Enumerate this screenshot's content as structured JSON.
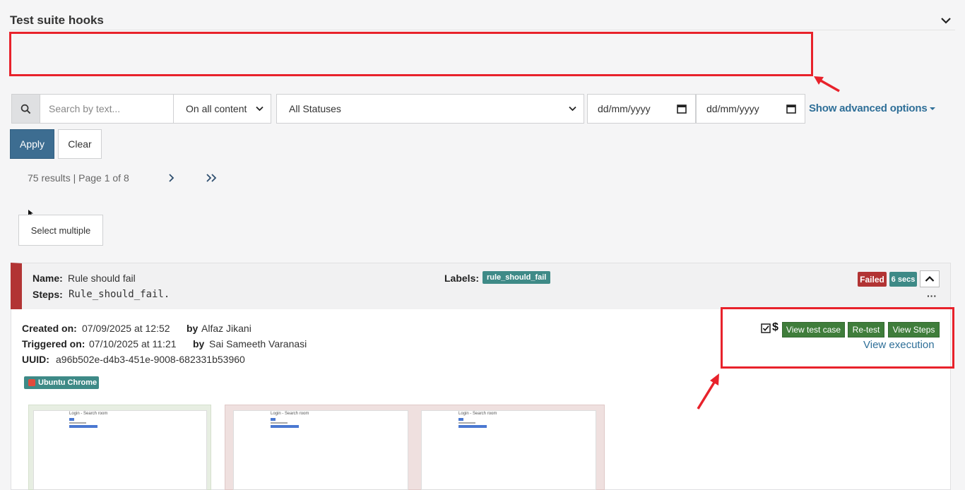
{
  "hooks": {
    "title": "Test suite hooks"
  },
  "filters": {
    "search_placeholder": "Search by text...",
    "content_scope": "On all content",
    "status": "All Statuses",
    "date_from_placeholder": "dd/mm/yyyy",
    "date_to_placeholder": "dd/mm/yyyy",
    "advanced_link": "Show advanced options",
    "apply_label": "Apply",
    "clear_label": "Clear"
  },
  "pagination": {
    "results_text": "75 results | Page 1 of 8"
  },
  "select_multiple_label": "Select multiple",
  "test_case": {
    "name_label": "Name:",
    "name": "Rule should fail",
    "steps_label": "Steps:",
    "steps": "Rule_should_fail.",
    "labels_label": "Labels:",
    "label_tag": "rule_should_fail",
    "status": "Failed",
    "duration": "6 secs",
    "created_label": "Created on:",
    "created_at": "07/09/2025 at 12:52",
    "by_label": "by",
    "created_by": "Alfaz Jikani",
    "triggered_label": "Triggered on:",
    "triggered_at": "07/10/2025 at 11:21",
    "triggered_by": "Sai Sameeth Varanasi",
    "uuid_label": "UUID:",
    "uuid": "a96b502e-d4b3-451e-9008-682331b53960",
    "environment": "Ubuntu Chrome",
    "dollar_symbol": "$",
    "actions": {
      "view_test_case": "View test case",
      "retest": "Re-test",
      "view_steps": "View Steps",
      "view_execution": "View execution"
    },
    "screenshots": [
      {
        "title": "Login - Search room"
      },
      {
        "title": "Login - Search room"
      },
      {
        "title": "Login - Search room"
      }
    ]
  },
  "colors": {
    "primary": "#3d6d91",
    "link": "#2f6f98",
    "failed": "#b23434",
    "teal": "#3e8a87",
    "action_green": "#3f7d3b",
    "annotation_red": "#e8222b"
  }
}
